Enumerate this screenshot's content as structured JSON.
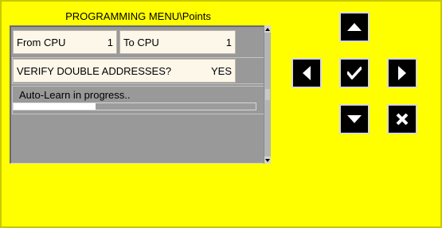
{
  "title": "PROGRAMMING MENU\\Points",
  "from_cpu": {
    "label": "From CPU",
    "value": "1"
  },
  "to_cpu": {
    "label": "To CPU",
    "value": "1"
  },
  "verify": {
    "label": "VERIFY DOUBLE ADDRESSES?",
    "value": "YES"
  },
  "status": {
    "text": "Auto-Learn in progress..",
    "progress_fraction": 0.34
  },
  "colors": {
    "background": "#ffff00",
    "panel": "#999999",
    "field": "#fdf7ea",
    "key": "#000000"
  },
  "keys": [
    "arrow-up-icon",
    "arrow-left-icon",
    "check-icon",
    "arrow-right-icon",
    "arrow-down-icon",
    "cancel-icon"
  ]
}
